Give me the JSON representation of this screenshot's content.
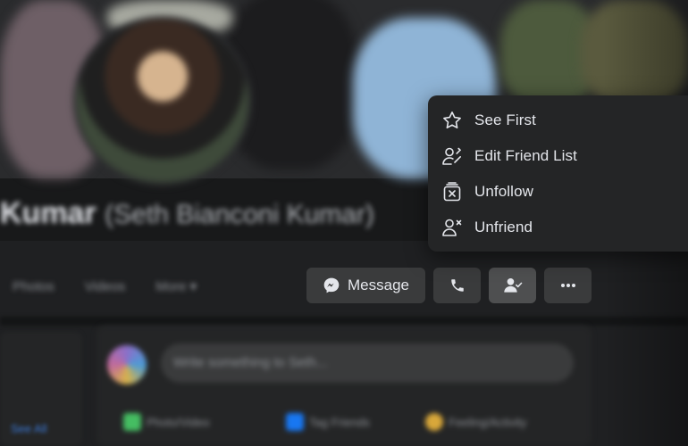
{
  "profile": {
    "name": "Kumar",
    "alt_name": "(Seth Bianconi Kumar)"
  },
  "tabs": [
    "Photos",
    "Videos",
    "More ▾"
  ],
  "composer": {
    "placeholder": "Write something to Seth...",
    "actions": [
      "Photo/Video",
      "Tag Friends",
      "Feeling/Activity"
    ]
  },
  "left_card": {
    "link": "See All"
  },
  "actions": {
    "message_label": "Message",
    "message_icon": "messenger-icon",
    "call_icon": "phone-icon",
    "friends_icon": "friends-check-icon",
    "more_icon": "more-dots-icon"
  },
  "menu": {
    "items": [
      {
        "label": "See First",
        "icon": "star-icon"
      },
      {
        "label": "Edit Friend List",
        "icon": "person-edit-icon"
      },
      {
        "label": "Unfollow",
        "icon": "unfollow-icon"
      },
      {
        "label": "Unfriend",
        "icon": "person-remove-icon"
      }
    ]
  },
  "colors": {
    "background": "#18191a",
    "surface": "#242526",
    "button": "#3a3b3c",
    "button_active": "#4e4f50",
    "text": "#e4e6eb",
    "secondary_text": "#b0b3b8"
  }
}
